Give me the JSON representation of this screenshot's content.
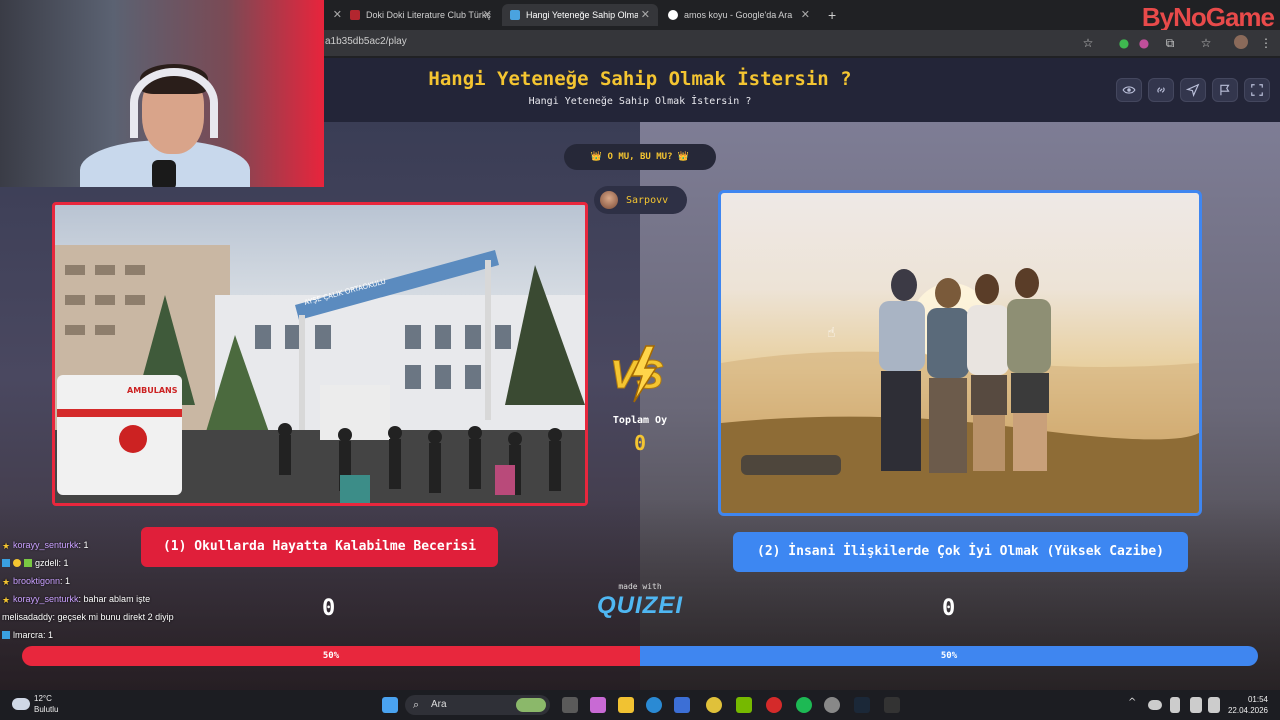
{
  "browser": {
    "tabs": [
      {
        "label": "Doki Doki Literature Club Türkç"
      },
      {
        "label": "Hangi Yeteneğe Sahip Olmak İs"
      },
      {
        "label": "amos koyu - Google'da Ara"
      }
    ],
    "url": "a1b35db5ac2/play",
    "brand": "ByNoGame"
  },
  "header": {
    "title": "Hangi Yeteneğe Sahip Olmak İstersin ?",
    "subtitle": "Hangi Yeteneğe Sahip Olmak İstersin ?",
    "icons": [
      "eye-icon",
      "link-icon",
      "send-icon",
      "flag-icon",
      "fullscreen-icon"
    ]
  },
  "game": {
    "mode_label": "👑 O MU, BU MU? 👑",
    "username": "Sarpovv",
    "vs_label": "VS",
    "total_votes_label": "Toplam Oy",
    "total_votes": "0",
    "option1": {
      "label": "(1) Okullarda Hayatta Kalabilme Becerisi",
      "votes": "0",
      "percent": "50%"
    },
    "option2": {
      "label": "(2) İnsani İlişkilerde Çok İyi Olmak (Yüksek Cazibe)",
      "votes": "0",
      "percent": "50%"
    },
    "vote_split": 0.5,
    "made_with": "made with",
    "logo": "QUIZEI",
    "image1": {
      "sign_text": "AYŞE ÇALIK ORTAOKULU",
      "vehicle_text": "AMBULANS"
    }
  },
  "chat": [
    {
      "user": "korayy_senturkk",
      "text": ": 1",
      "badge": "star"
    },
    {
      "user": "gzdell",
      "text": ": 1",
      "badge": "multi"
    },
    {
      "user": "brooktigonn",
      "text": ": 1",
      "badge": "star"
    },
    {
      "user": "korayy_senturkk",
      "text": ": bahar ablam işte",
      "badge": "star"
    },
    {
      "user": "melisadaddy",
      "text": ": geçsek mi bunu direkt 2 diyip",
      "badge": "none"
    },
    {
      "user": "lmarcra",
      "text": ": 1",
      "badge": "blue"
    }
  ],
  "taskbar": {
    "weather_temp": "12°C",
    "weather_desc": "Bulutlu",
    "search_placeholder": "Ara",
    "time": "01:54",
    "date": "22.04.2026"
  },
  "colors": {
    "red": "#e8273d",
    "blue": "#3f86f0",
    "gold": "#f4c531",
    "header": "#232538"
  }
}
